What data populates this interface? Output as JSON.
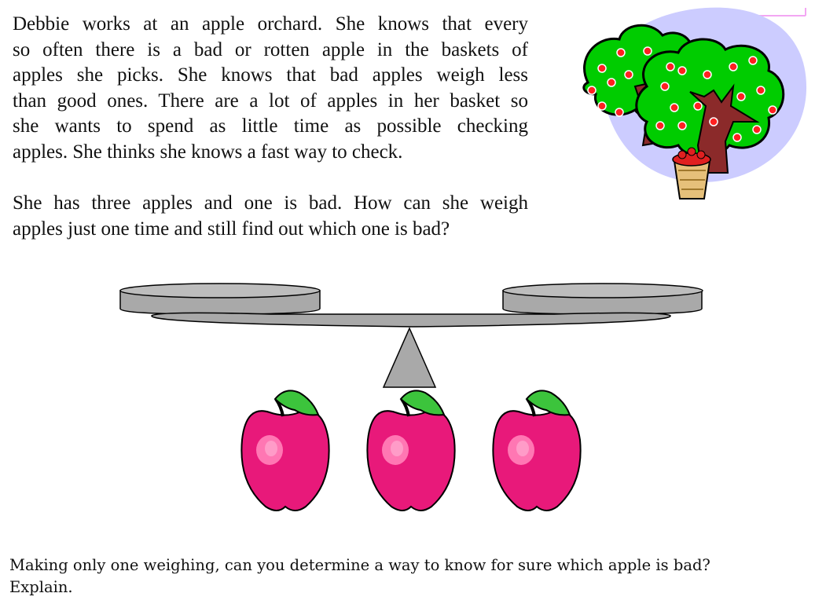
{
  "story": {
    "paragraph1_lines": [
      "Debbie works at an apple orchard. She knows that every",
      "so often there is a bad or rotten apple in the baskets of",
      "apples she picks. She knows that bad apples weigh less",
      "than good ones. There are a lot of apples in her basket so",
      "she wants to spend as little time as possible checking",
      "apples. She thinks she knows a fast way to check."
    ],
    "paragraph2_lines": [
      "She has three apples and one is bad. How can she weigh",
      "apples just one time and still find out which one is bad?"
    ]
  },
  "question": {
    "line1": "Making only one weighing, can you determine a way to know for sure which apple is bad?",
    "line2": "Explain."
  },
  "illustrations": {
    "orchard": "apple-tree-with-basket",
    "scale": "balance-scale",
    "apples": [
      "apple",
      "apple",
      "apple"
    ]
  },
  "colors": {
    "apple": "#e8197a",
    "leaf": "#3cc43c",
    "tree_leaves": "#00cc00",
    "trunk": "#8b2a2a",
    "sky_blob": "#ccccff",
    "scale": "#a9a9a9"
  }
}
